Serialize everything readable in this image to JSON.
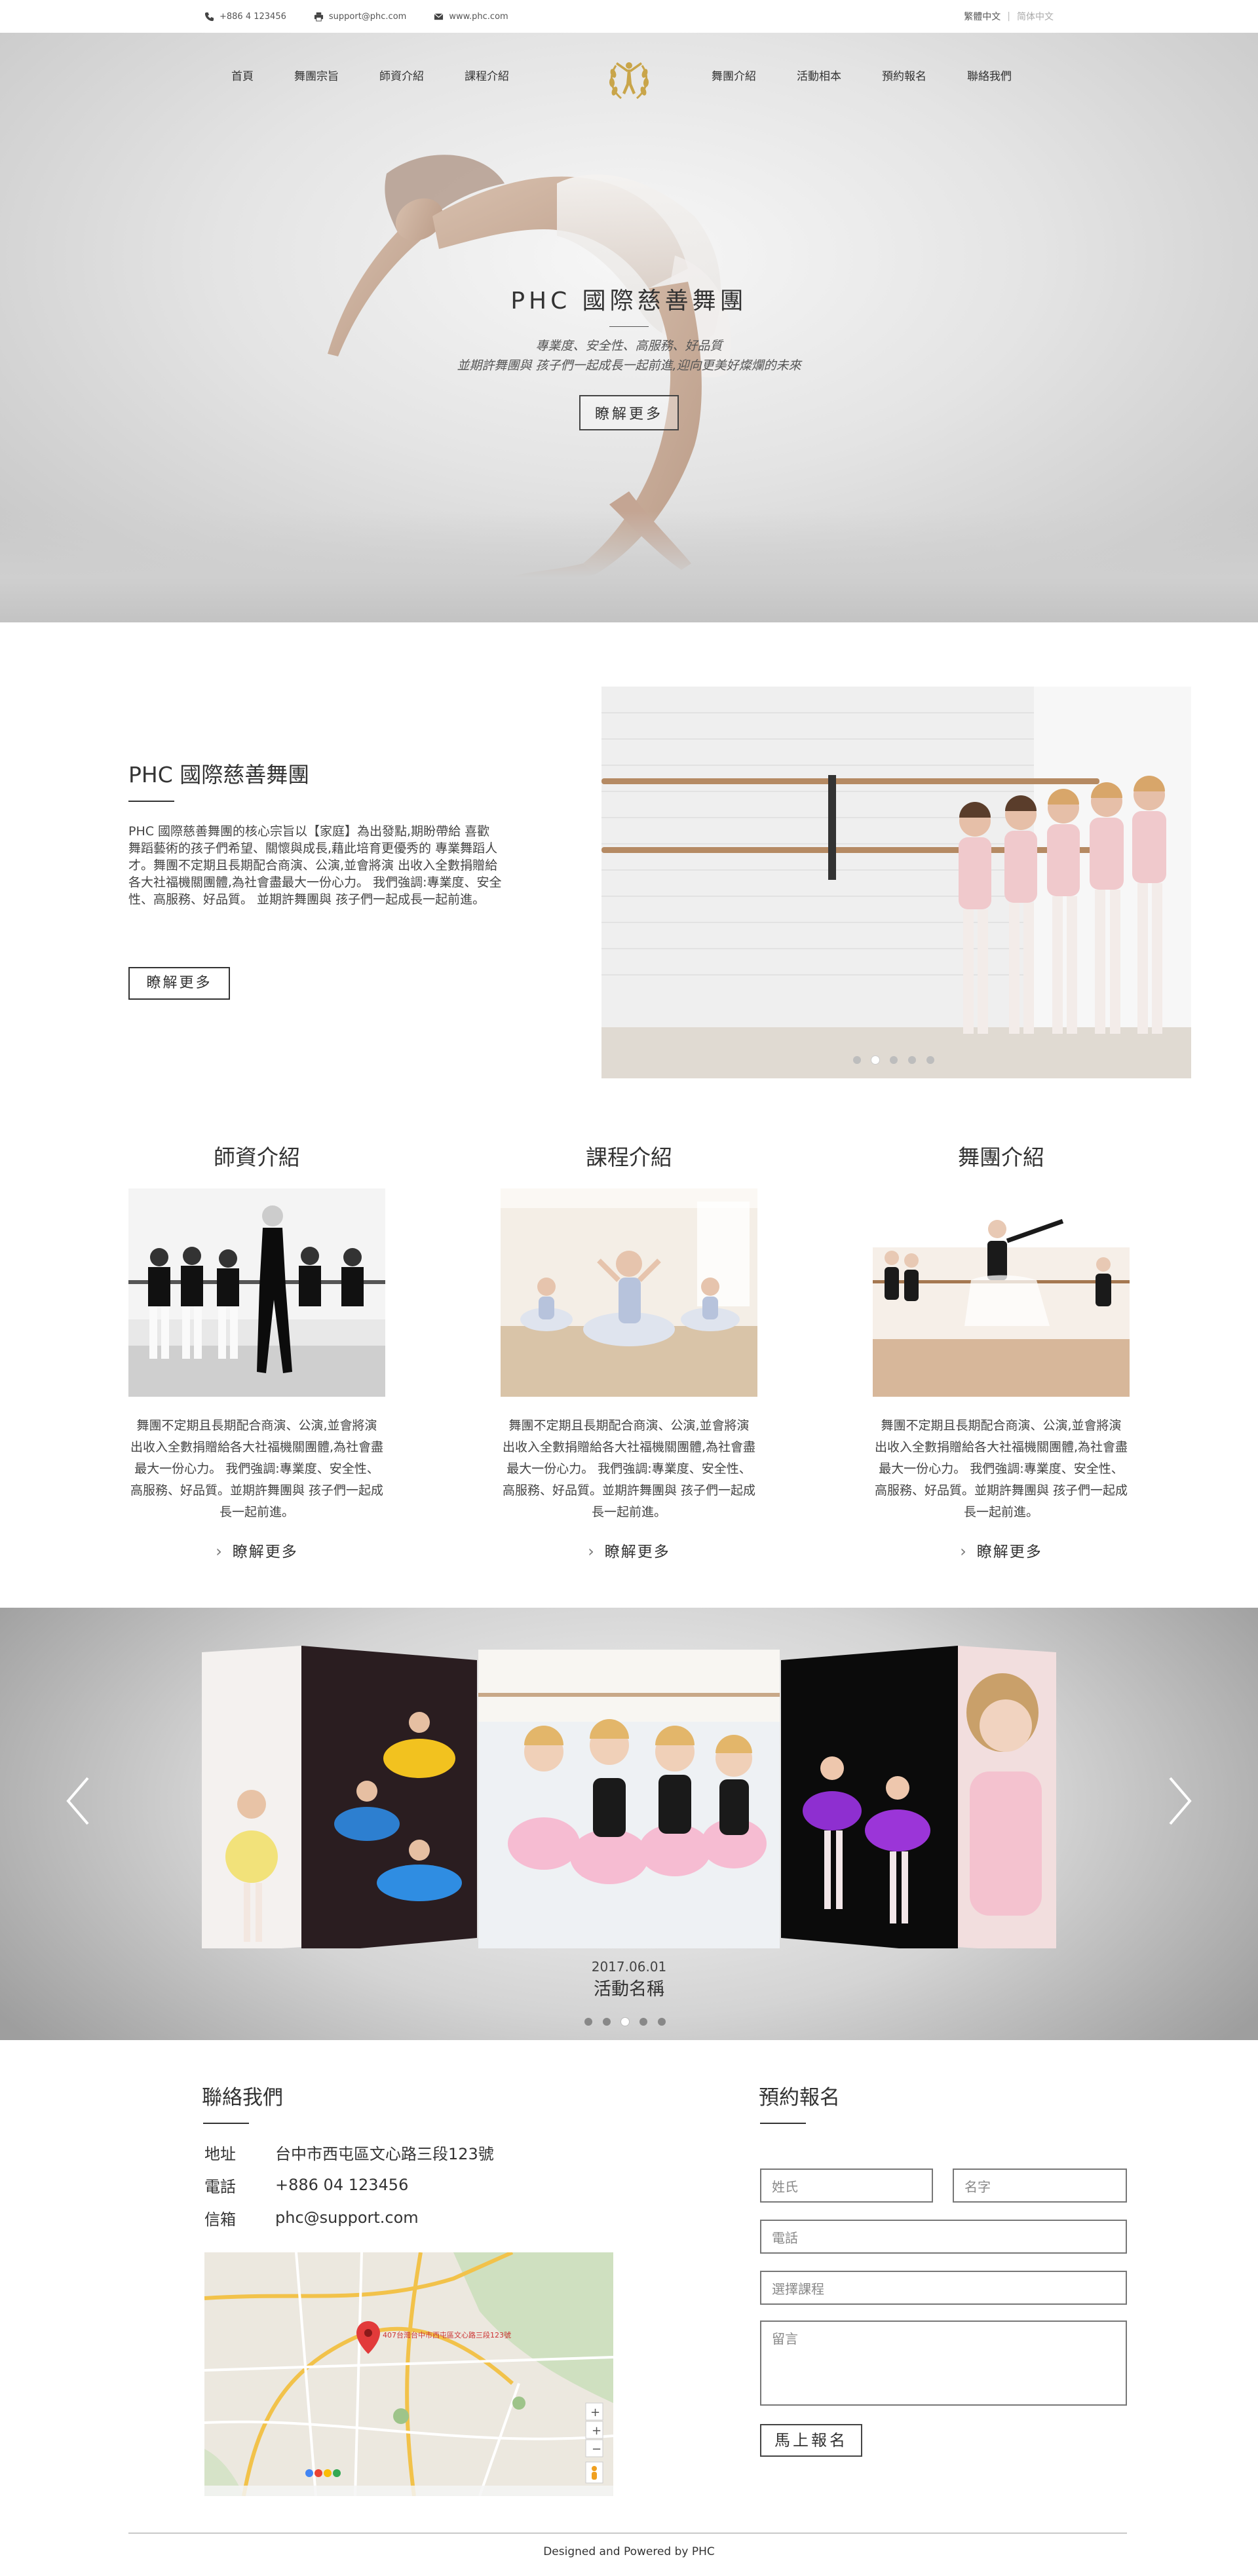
{
  "topbar": {
    "phone": "+886 4 123456",
    "email": "support@phc.com",
    "website": "www.phc.com",
    "lang_active": "繁體中文",
    "lang_other": "简体中文"
  },
  "nav": {
    "left": [
      "首頁",
      "舞團宗旨",
      "師資介紹",
      "課程介紹"
    ],
    "right": [
      "舞團介紹",
      "活動相本",
      "預約報名",
      "聯絡我們"
    ]
  },
  "hero": {
    "title": "PHC 國際慈善舞團",
    "line1": "專業度、安全性、高服務、好品質",
    "line2": "並期許舞團與 孩子們一起成長一起前進,迎向更美好燦爛的未來",
    "button": "瞭解更多"
  },
  "about": {
    "title": "PHC 國際慈善舞團",
    "body": "PHC 國際慈善舞團的核心宗旨以【家庭】為出發點,期盼帶給 喜歡舞蹈藝術的孩子們希望、關懷與成長,藉此培育更優秀的 專業舞蹈人才。舞團不定期且長期配合商演、公演,並會將演 出收入全數捐贈給各大社福機關團體,為社會盡最大一份心力。 我們強調:專業度、安全性、高服務、好品質。 並期許舞團與 孩子們一起成長一起前進。",
    "button": "瞭解更多",
    "slide_count": 5,
    "active_slide": 1
  },
  "cards": [
    {
      "title": "師資介紹",
      "body": "舞團不定期且長期配合商演、公演,並會將演 出收入全數捐贈給各大社福機關團體,為社會盡最大一份心力。 我們強調:專業度、安全性、高服務、好品質。並期許舞團與 孩子們一起成長一起前進。",
      "more": "瞭解更多"
    },
    {
      "title": "課程介紹",
      "body": "舞團不定期且長期配合商演、公演,並會將演 出收入全數捐贈給各大社福機關團體,為社會盡最大一份心力。 我們強調:專業度、安全性、高服務、好品質。並期許舞團與 孩子們一起成長一起前進。",
      "more": "瞭解更多"
    },
    {
      "title": "舞團介紹",
      "body": "舞團不定期且長期配合商演、公演,並會將演 出收入全數捐贈給各大社福機關團體,為社會盡最大一份心力。 我們強調:專業度、安全性、高服務、好品質。並期許舞團與 孩子們一起成長一起前進。",
      "more": "瞭解更多"
    }
  ],
  "gallery": {
    "date": "2017.06.01",
    "name": "活動名稱",
    "slide_count": 5,
    "active_slide": 2
  },
  "contact": {
    "title": "聯絡我們",
    "address_label": "地址",
    "address": "台中市西屯區文心路三段123號",
    "phone_label": "電話",
    "phone": "+886 04 123456",
    "email_label": "信箱",
    "email": "phc@support.com",
    "map_pin": "407台灣台中市西屯區文心路三段123號"
  },
  "booking": {
    "title": "預約報名",
    "surname_placeholder": "姓氏",
    "name_placeholder": "名字",
    "phone_placeholder": "電話",
    "course_placeholder": "選擇課程",
    "message_placeholder": "留言",
    "submit": "馬上報名"
  },
  "footer": {
    "text": "Designed and Powered by PHC"
  },
  "colors": {
    "accent_gold": "#c9a54a",
    "text_dark": "#333333"
  }
}
